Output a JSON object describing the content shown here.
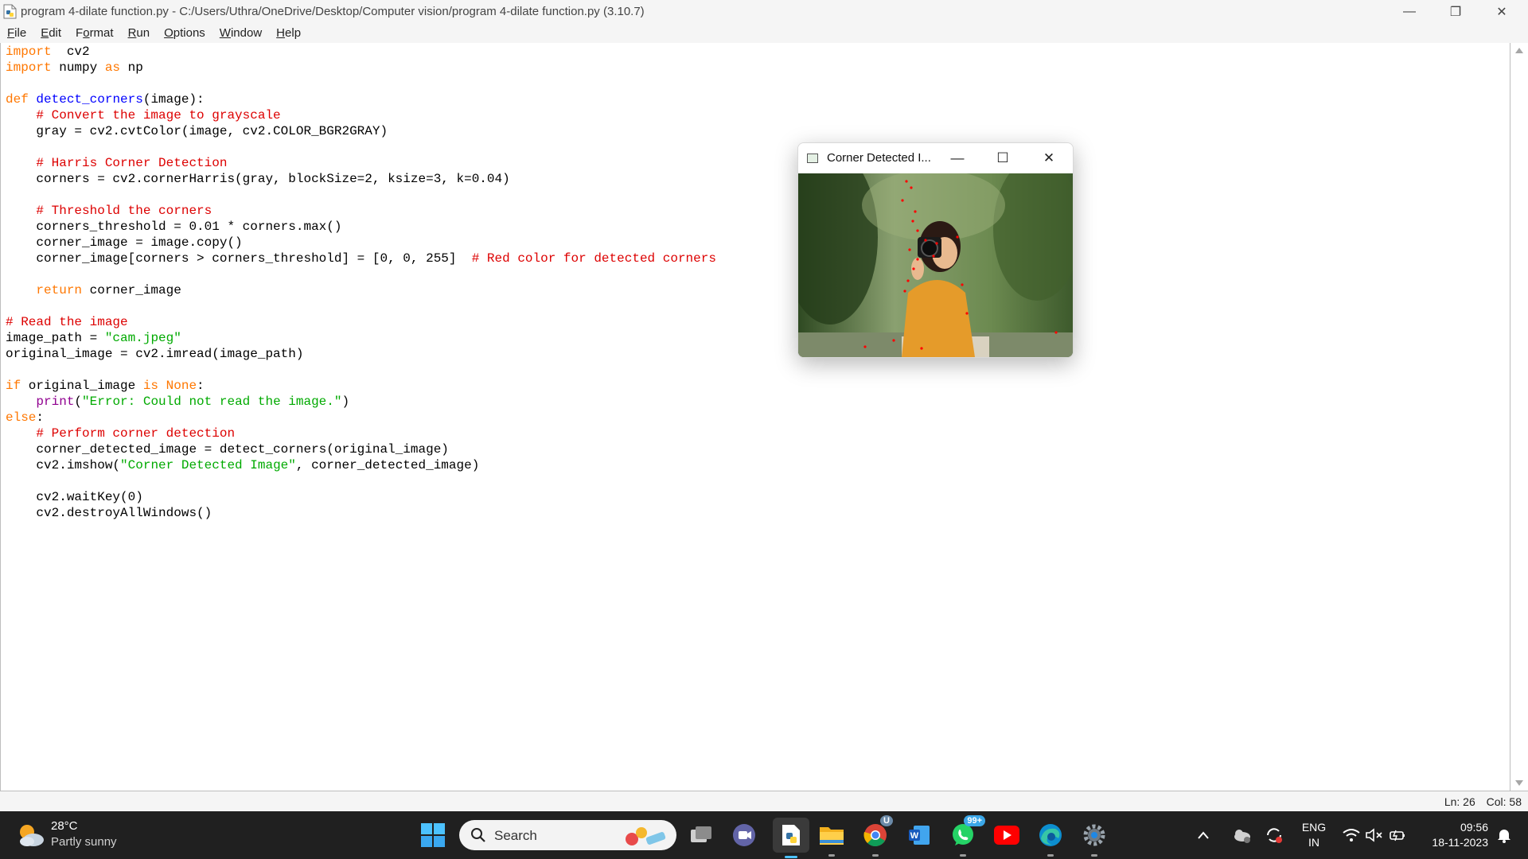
{
  "window": {
    "title": "program 4-dilate function.py - C:/Users/Uthra/OneDrive/Desktop/Computer vision/program 4-dilate function.py (3.10.7)",
    "minimize_glyph": "—",
    "restore_glyph": "❐",
    "close_glyph": "✕"
  },
  "menu": [
    {
      "u": "F",
      "rest": "ile"
    },
    {
      "u": "E",
      "rest": "dit"
    },
    {
      "pre": "F",
      "u": "o",
      "rest": "rmat"
    },
    {
      "u": "R",
      "rest": "un"
    },
    {
      "u": "O",
      "rest": "ptions"
    },
    {
      "u": "W",
      "rest": "indow"
    },
    {
      "u": "H",
      "rest": "elp"
    }
  ],
  "code_lines": [
    [
      [
        "kw",
        "import"
      ],
      [
        "",
        "  cv2"
      ]
    ],
    [
      [
        "kw",
        "import"
      ],
      [
        "",
        " numpy "
      ],
      [
        "kw",
        "as"
      ],
      [
        "",
        " np"
      ]
    ],
    [],
    [
      [
        "kw",
        "def"
      ],
      [
        "",
        " "
      ],
      [
        "df",
        "detect_corners"
      ],
      [
        "",
        "(image):"
      ]
    ],
    [
      [
        "",
        "    "
      ],
      [
        "cm",
        "# Convert the image to grayscale"
      ]
    ],
    [
      [
        "",
        "    gray = cv2.cvtColor(image, cv2.COLOR_BGR2GRAY)"
      ]
    ],
    [],
    [
      [
        "",
        "    "
      ],
      [
        "cm",
        "# Harris Corner Detection"
      ]
    ],
    [
      [
        "",
        "    corners = cv2.cornerHarris(gray, blockSize=2, ksize=3, k=0.04)"
      ]
    ],
    [],
    [
      [
        "",
        "    "
      ],
      [
        "cm",
        "# Threshold the corners"
      ]
    ],
    [
      [
        "",
        "    corners_threshold = 0.01 * corners.max()"
      ]
    ],
    [
      [
        "",
        "    corner_image = image.copy()"
      ]
    ],
    [
      [
        "",
        "    corner_image[corners > corners_threshold] = [0, 0, 255]  "
      ],
      [
        "cm",
        "# Red color for detected corners"
      ]
    ],
    [],
    [
      [
        "",
        "    "
      ],
      [
        "kw",
        "return"
      ],
      [
        "",
        " corner_image"
      ]
    ],
    [],
    [
      [
        "cm",
        "# Read the image"
      ]
    ],
    [
      [
        "",
        "image_path = "
      ],
      [
        "st",
        "\"cam.jpeg\""
      ]
    ],
    [
      [
        "",
        "original_image = cv2.imread(image_path)"
      ]
    ],
    [],
    [
      [
        "kw",
        "if"
      ],
      [
        "",
        " original_image "
      ],
      [
        "kw",
        "is"
      ],
      [
        "",
        " "
      ],
      [
        "kw",
        "None"
      ],
      [
        "",
        ":"
      ]
    ],
    [
      [
        "",
        "    "
      ],
      [
        "bi",
        "print"
      ],
      [
        "",
        "("
      ],
      [
        "st",
        "\"Error: Could not read the image.\""
      ],
      [
        "",
        ")"
      ]
    ],
    [
      [
        "kw",
        "else"
      ],
      [
        "",
        ":"
      ]
    ],
    [
      [
        "",
        "    "
      ],
      [
        "cm",
        "# Perform corner detection"
      ]
    ],
    [
      [
        "",
        "    corner_detected_image = detect_corners(original_image)"
      ]
    ],
    [
      [
        "",
        "    cv2.imshow("
      ],
      [
        "st",
        "\"Corner Detected Image\""
      ],
      [
        "",
        ", corner_detected_image)"
      ]
    ],
    [],
    [
      [
        "",
        "    cv2.waitKey(0)"
      ]
    ],
    [
      [
        "",
        "    cv2.destroyAllWindows()"
      ]
    ]
  ],
  "status": {
    "line": "Ln: 26",
    "col": "Col: 58"
  },
  "cv_window": {
    "title": "Corner Detected I...",
    "minimize_glyph": "—",
    "maximize_glyph": "☐",
    "close_glyph": "✕"
  },
  "taskbar": {
    "weather_temp": "28°C",
    "weather_desc": "Partly sunny",
    "search_label": "Search",
    "chrome_badge": "U",
    "whatsapp_badge": "99+",
    "lang_top": "ENG",
    "lang_bottom": "IN",
    "time": "09:56",
    "date": "18-11-2023"
  },
  "colors": {
    "keyword": "#ff7700",
    "builtin": "#900090",
    "definition": "#0000ff",
    "comment": "#dd0000",
    "string": "#00aa00",
    "taskbar": "#202020"
  }
}
